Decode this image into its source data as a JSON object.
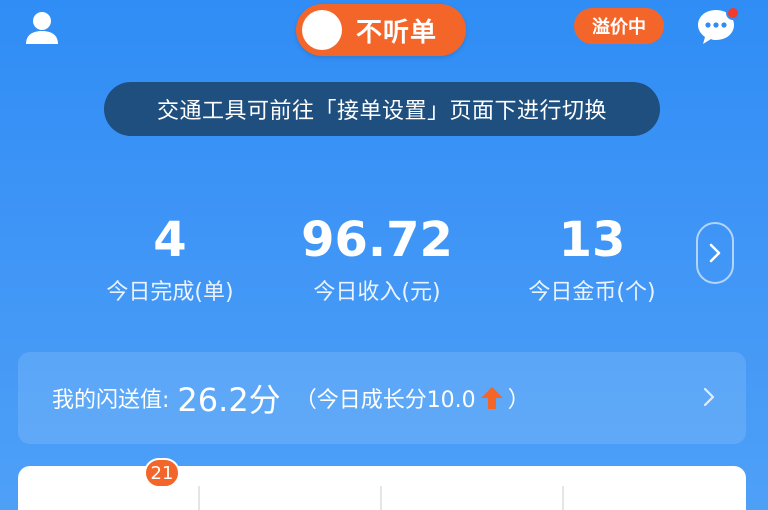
{
  "header": {
    "toggle_label": "不听单",
    "premium_badge": "溢价中"
  },
  "tooltip": {
    "text": "交通工具可前往「接单设置」页面下进行切换"
  },
  "stats": [
    {
      "value": "4",
      "label": "今日完成(单)"
    },
    {
      "value": "96.72",
      "label": "今日收入(元)"
    },
    {
      "value": "13",
      "label": "今日金币(个)"
    }
  ],
  "score": {
    "label": "我的闪送值:",
    "value": "26.2分",
    "growth_prefix": "（今日成长分10.0",
    "growth_suffix": "）"
  },
  "tabs": {
    "first_badge": "21"
  },
  "colors": {
    "accent_orange": "#f4652a",
    "bg_blue": "#2f8df5",
    "tooltip_bg": "#1f4f7e",
    "notification_red": "#f23b2c"
  }
}
